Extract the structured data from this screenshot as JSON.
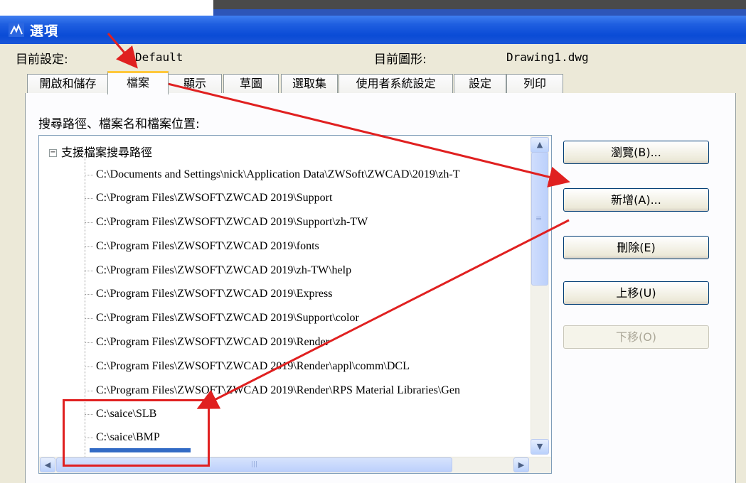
{
  "window": {
    "title": "選項"
  },
  "header": {
    "current_profile_label": "目前設定:",
    "current_profile_value": "Default",
    "current_drawing_label": "目前圖形:",
    "current_drawing_value": "Drawing1.dwg"
  },
  "tabs": [
    {
      "label": "開啟和儲存",
      "active": false
    },
    {
      "label": "檔案",
      "active": true
    },
    {
      "label": "顯示",
      "active": false
    },
    {
      "label": "草圖",
      "active": false
    },
    {
      "label": "選取集",
      "active": false
    },
    {
      "label": "使用者系統設定",
      "active": false
    },
    {
      "label": "設定",
      "active": false
    },
    {
      "label": "列印",
      "active": false
    }
  ],
  "files_panel": {
    "group_label": "搜尋路徑、檔案名和檔案位置:",
    "tree_root": {
      "label": "支援檔案搜尋路徑",
      "expander": "−"
    },
    "tree_items": [
      "C:\\Documents and Settings\\nick\\Application Data\\ZWSoft\\ZWCAD\\2019\\zh-T",
      "C:\\Program Files\\ZWSOFT\\ZWCAD 2019\\Support",
      "C:\\Program Files\\ZWSOFT\\ZWCAD 2019\\Support\\zh-TW",
      "C:\\Program Files\\ZWSOFT\\ZWCAD 2019\\fonts",
      "C:\\Program Files\\ZWSOFT\\ZWCAD 2019\\zh-TW\\help",
      "C:\\Program Files\\ZWSOFT\\ZWCAD 2019\\Express",
      "C:\\Program Files\\ZWSOFT\\ZWCAD 2019\\Support\\color",
      "C:\\Program Files\\ZWSOFT\\ZWCAD 2019\\Render",
      "C:\\Program Files\\ZWSOFT\\ZWCAD 2019\\Render\\appl\\comm\\DCL",
      "C:\\Program Files\\ZWSOFT\\ZWCAD 2019\\Render\\RPS Material Libraries\\Gen",
      "C:\\saice\\SLB",
      "C:\\saice\\BMP"
    ]
  },
  "buttons": {
    "browse": "瀏覽(B)...",
    "add": "新增(A)...",
    "remove": "刪除(E)",
    "move_up": "上移(U)",
    "move_down": "下移(O)"
  },
  "scroll_icons": {
    "up": "▲",
    "down": "▼",
    "left": "◀",
    "right": "▶",
    "grip": "≡",
    "hgrip": "|||"
  },
  "colors": {
    "titlebar": "#0a4bd6",
    "annotation_red": "#e02020",
    "active_tab_accent": "#ffc83c"
  }
}
